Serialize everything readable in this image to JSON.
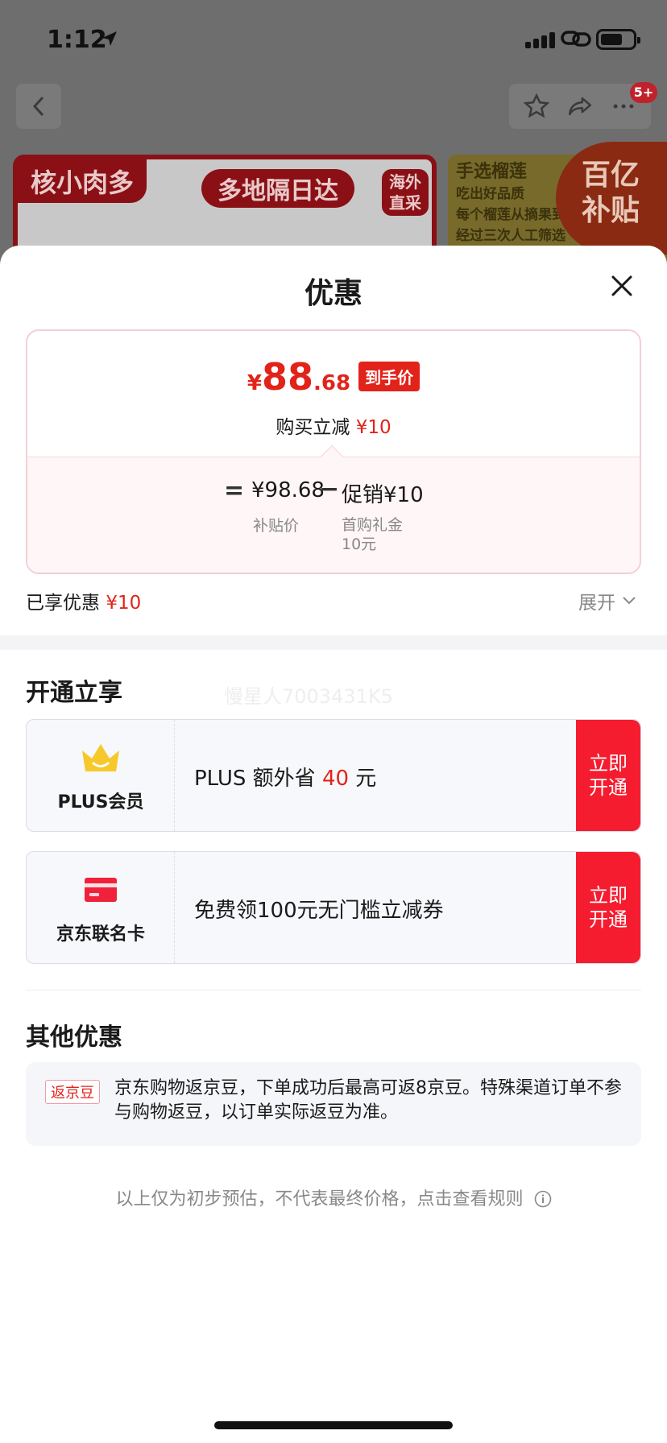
{
  "status_bar": {
    "time": "1:12"
  },
  "nav": {
    "badge": "5+"
  },
  "background_banners": {
    "banner1_tag": "核小肉多",
    "banner1_pill": "多地隔日达",
    "banner1_badge_line1": "海外",
    "banner1_badge_line2": "直采",
    "banner2_line1": "手选榴莲",
    "banner2_line2": "吃出好品质",
    "banner2_line3": "每个榴莲从摘果到",
    "banner2_line4": "经过三次人工筛选",
    "banner2_circle_line1": "百亿",
    "banner2_circle_line2": "补贴"
  },
  "sheet": {
    "title": "优惠",
    "price": {
      "yen": "¥",
      "integer": "88",
      "decimal": ".68",
      "tag": "到手价",
      "sub_label": "购买立减",
      "sub_value": "¥10"
    },
    "formula": {
      "equals": "=",
      "base_price": "¥98.68",
      "base_label": "补贴价",
      "minus": "−",
      "promo": "促销¥10",
      "promo_label_line1": "首购礼金",
      "promo_label_line2": "10元"
    },
    "enjoyed_label": "已享优惠",
    "enjoyed_value": "¥10",
    "expand_label": "展开",
    "open_section_title": "开通立享",
    "watermark": "慢星人7003431K5",
    "offers": [
      {
        "left_label": "PLUS会员",
        "text_prefix": "PLUS 额外省 ",
        "text_highlight": "40",
        "text_suffix": " 元",
        "button_line1": "立即",
        "button_line2": "开通",
        "icon": "crown-icon"
      },
      {
        "left_label": "京东联名卡",
        "text": "免费领100元无门槛立减券",
        "button_line1": "立即",
        "button_line2": "开通",
        "icon": "card-icon"
      }
    ],
    "other_section_title": "其他优惠",
    "other_badge": "返京豆",
    "other_text": "京东购物返京豆，下单成功后最高可返8京豆。特殊渠道订单不参与购物返豆，以订单实际返豆为准。",
    "footer_note": "以上仅为初步预估，不代表最终价格，点击查看规则"
  },
  "colors": {
    "accent_red": "#e2231a",
    "button_red": "#f51c2f",
    "crown_yellow": "#f7c82a"
  }
}
